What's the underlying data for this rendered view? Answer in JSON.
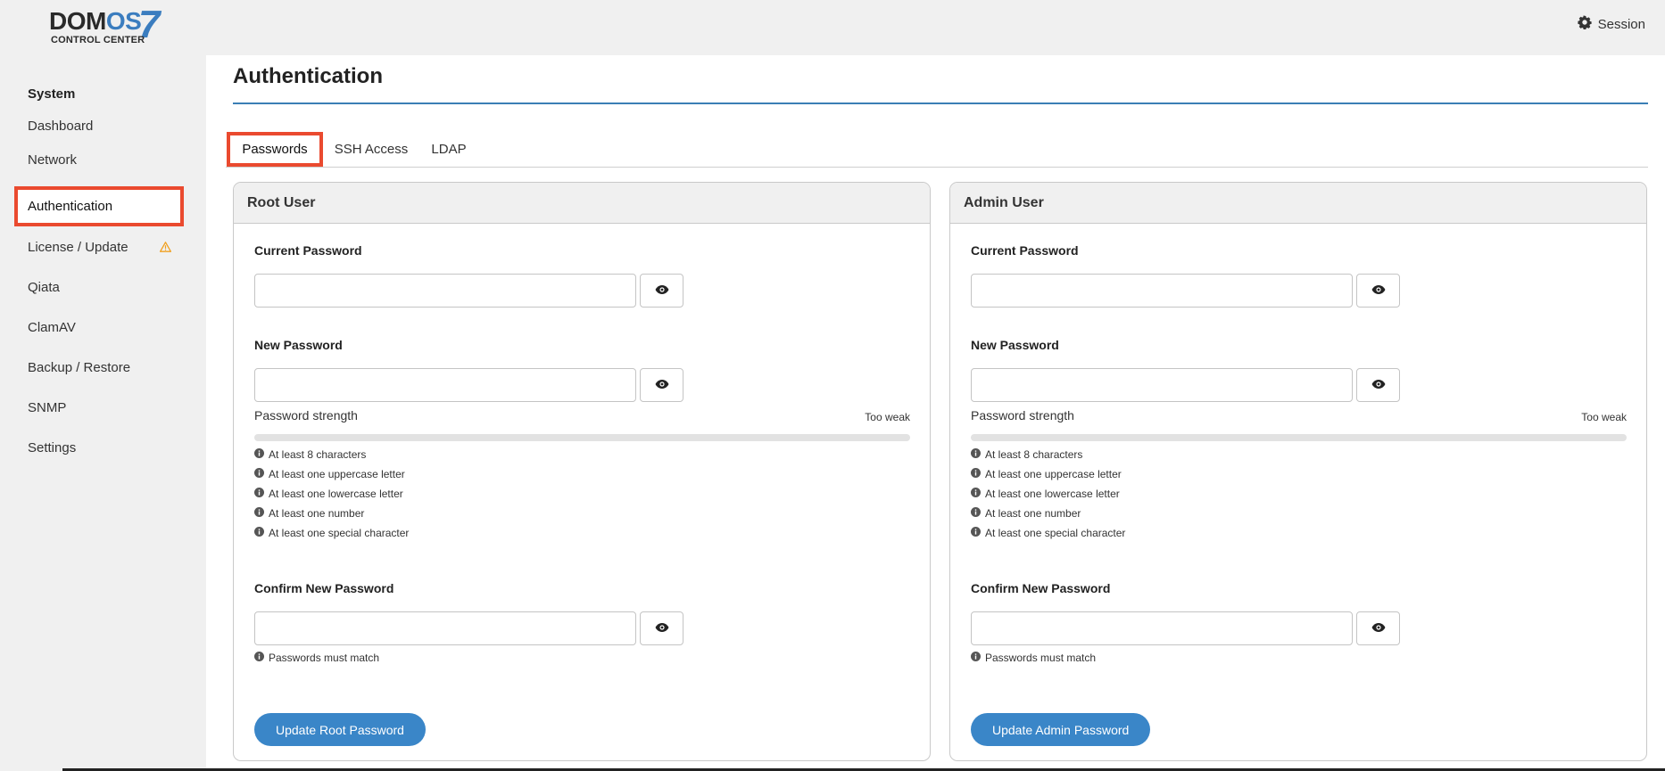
{
  "app": {
    "logo_main_a": "DOM",
    "logo_main_b": "OS",
    "logo_version": "7",
    "logo_sub": "CONTROL CENTER",
    "session_label": "Session"
  },
  "sidebar": {
    "heading": "System",
    "items": [
      {
        "label": "Dashboard"
      },
      {
        "label": "Network"
      },
      {
        "label": "Authentication",
        "active": true
      },
      {
        "label": "License / Update",
        "warning": true
      },
      {
        "label": "Qiata"
      },
      {
        "label": "ClamAV"
      },
      {
        "label": "Backup / Restore"
      },
      {
        "label": "SNMP"
      },
      {
        "label": "Settings"
      }
    ]
  },
  "page": {
    "title": "Authentication",
    "tabs": [
      {
        "label": "Passwords",
        "active": true
      },
      {
        "label": "SSH Access"
      },
      {
        "label": "LDAP"
      }
    ]
  },
  "cards": [
    {
      "title": "Root User",
      "current_label": "Current Password",
      "current_value": "",
      "new_label": "New Password",
      "new_value": "",
      "strength_label": "Password strength",
      "strength_value": "Too weak",
      "strength_level": 0,
      "rules": [
        "At least 8 characters",
        "At least one uppercase letter",
        "At least one lowercase letter",
        "At least one number",
        "At least one special character"
      ],
      "confirm_label": "Confirm New Password",
      "confirm_value": "",
      "match_note": "Passwords must match",
      "button_label": "Update Root Password"
    },
    {
      "title": "Admin User",
      "current_label": "Current Password",
      "current_value": "",
      "new_label": "New Password",
      "new_value": "",
      "strength_label": "Password strength",
      "strength_value": "Too weak",
      "strength_level": 0,
      "rules": [
        "At least 8 characters",
        "At least one uppercase letter",
        "At least one lowercase letter",
        "At least one number",
        "At least one special character"
      ],
      "confirm_label": "Confirm New Password",
      "confirm_value": "",
      "match_note": "Passwords must match",
      "button_label": "Update Admin Password"
    }
  ],
  "icons": {
    "session": "gear-icon",
    "warning": "warning-triangle-icon",
    "reveal": "eye-icon",
    "info": "info-circle-icon"
  },
  "colors": {
    "accent": "#3a86c8",
    "title_rule": "#3a7fb5",
    "highlight": "#ea4a2f",
    "warning": "#f0a020",
    "sidebar_bg": "#f0f0f0"
  }
}
